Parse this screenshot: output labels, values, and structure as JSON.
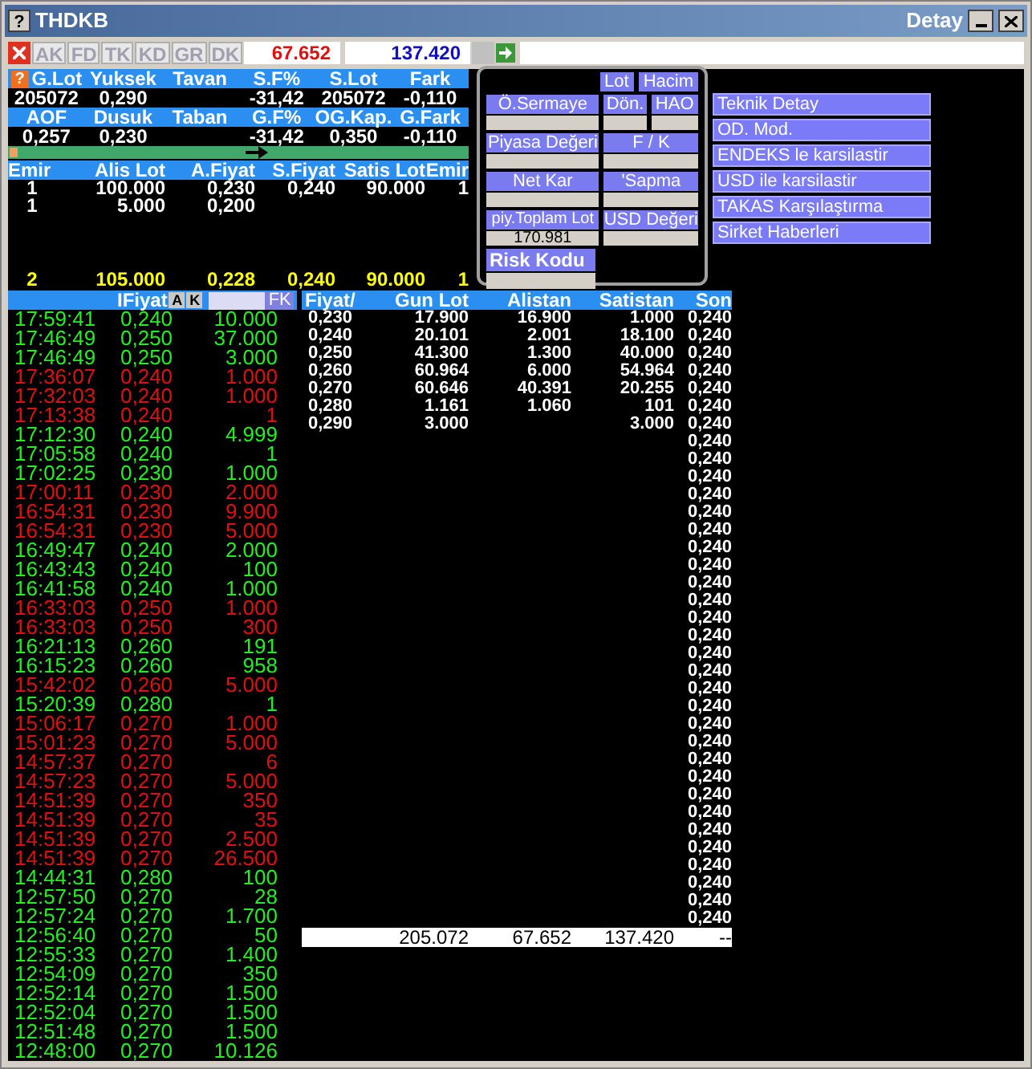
{
  "window": {
    "icon_glyph": "?",
    "title": "THDKB",
    "right_title": "Detay"
  },
  "toolbar": {
    "tabs": [
      "AK",
      "FD",
      "TK",
      "KD",
      "GR",
      "DK"
    ],
    "buy_total": "67.652",
    "sell_total": "137.420"
  },
  "stats": {
    "help_glyph": "?",
    "rows": [
      [
        {
          "header": "G.Lot",
          "value": "205072"
        },
        {
          "header": "Yuksek",
          "value": "0,290"
        },
        {
          "header": "Tavan"
        },
        {
          "header": "S.F%",
          "value": "-31,42"
        },
        {
          "header": "S.Lot",
          "value": "205072"
        },
        {
          "header": "Fark",
          "value": "-0,110"
        }
      ],
      [
        {
          "header": "AOF",
          "value": "0,257"
        },
        {
          "header": "Dusuk",
          "value": "0,230"
        },
        {
          "header": "Taban"
        },
        {
          "header": "G.F%",
          "value": "-31,42"
        },
        {
          "header": "OG.Kap.",
          "value": "0,350"
        },
        {
          "header": "G.Fark",
          "value": "-0,110"
        }
      ]
    ]
  },
  "order_book": {
    "columns": [
      "Emir",
      "Alis Lot",
      "A.Fiyat",
      "S.Fiyat",
      "Satis Lot",
      "Emir"
    ],
    "rows": [
      [
        "1",
        "100.000",
        "0,230",
        "0,240",
        "90.000",
        "1"
      ],
      [
        "1",
        "5.000",
        "0,200",
        null,
        null,
        null
      ]
    ],
    "totals": [
      "2",
      "105.000",
      "0,228",
      "0,240",
      "90.000",
      "1"
    ]
  },
  "info_panel": {
    "toggles": [
      {
        "label": "Lot",
        "selected": false
      },
      {
        "label": "Hacim",
        "selected": false
      }
    ],
    "fields": [
      {
        "label": "Ö.Sermaye"
      },
      {
        "label": "Dön."
      },
      {
        "label": "HAO"
      },
      {
        "label": "Piyasa Değeri"
      },
      {
        "label": "F / K"
      },
      {
        "label": "Net Kar"
      },
      {
        "label": "'Sapma"
      },
      {
        "label": "piy.Toplam Lot",
        "value": "170.981"
      },
      {
        "label": "USD Değeri"
      }
    ],
    "risk_label": "Risk Kodu"
  },
  "menu": [
    "Teknik Detay",
    "OD. Mod.",
    "ENDEKS le karsilastir",
    "USD ile karsilastir",
    "TAKAS Karşılaştırma",
    "Sirket Haberleri"
  ],
  "trades": {
    "header": "IFiyat",
    "buttons": [
      "A",
      "K"
    ],
    "fk": "FK",
    "rows": [
      {
        "time": "17:59:41",
        "price": "0,240",
        "lot": "10.000",
        "color": "#22ee22"
      },
      {
        "time": "17:46:49",
        "price": "0,250",
        "lot": "37.000",
        "color": "#22ee22"
      },
      {
        "time": "17:46:49",
        "price": "0,250",
        "lot": "3.000",
        "color": "#22ee22"
      },
      {
        "time": "17:36:07",
        "price": "0,240",
        "lot": "1.000",
        "color": "#e01010"
      },
      {
        "time": "17:32:03",
        "price": "0,240",
        "lot": "1.000",
        "color": "#e01010"
      },
      {
        "time": "17:13:38",
        "price": "0,240",
        "lot": "1",
        "color": "#e01010"
      },
      {
        "time": "17:12:30",
        "price": "0,240",
        "lot": "4.999",
        "color": "#22ee22"
      },
      {
        "time": "17:05:58",
        "price": "0,240",
        "lot": "1",
        "color": "#22ee22"
      },
      {
        "time": "17:02:25",
        "price": "0,230",
        "lot": "1.000",
        "color": "#22ee22"
      },
      {
        "time": "17:00:11",
        "price": "0,230",
        "lot": "2.000",
        "color": "#e01010"
      },
      {
        "time": "16:54:31",
        "price": "0,230",
        "lot": "9.900",
        "color": "#e01010"
      },
      {
        "time": "16:54:31",
        "price": "0,230",
        "lot": "5.000",
        "color": "#e01010"
      },
      {
        "time": "16:49:47",
        "price": "0,240",
        "lot": "2.000",
        "color": "#22ee22"
      },
      {
        "time": "16:43:43",
        "price": "0,240",
        "lot": "100",
        "color": "#22ee22"
      },
      {
        "time": "16:41:58",
        "price": "0,240",
        "lot": "1.000",
        "color": "#22ee22"
      },
      {
        "time": "16:33:03",
        "price": "0,250",
        "lot": "1.000",
        "color": "#e01010"
      },
      {
        "time": "16:33:03",
        "price": "0,250",
        "lot": "300",
        "color": "#e01010"
      },
      {
        "time": "16:21:13",
        "price": "0,260",
        "lot": "191",
        "color": "#22ee22"
      },
      {
        "time": "16:15:23",
        "price": "0,260",
        "lot": "958",
        "color": "#22ee22"
      },
      {
        "time": "15:42:02",
        "price": "0,260",
        "lot": "5.000",
        "color": "#e01010"
      },
      {
        "time": "15:20:39",
        "price": "0,280",
        "lot": "1",
        "color": "#22ee22"
      },
      {
        "time": "15:06:17",
        "price": "0,270",
        "lot": "1.000",
        "color": "#e01010"
      },
      {
        "time": "15:01:23",
        "price": "0,270",
        "lot": "5.000",
        "color": "#e01010"
      },
      {
        "time": "14:57:37",
        "price": "0,270",
        "lot": "6",
        "color": "#e01010"
      },
      {
        "time": "14:57:23",
        "price": "0,270",
        "lot": "5.000",
        "color": "#e01010"
      },
      {
        "time": "14:51:39",
        "price": "0,270",
        "lot": "350",
        "color": "#e01010"
      },
      {
        "time": "14:51:39",
        "price": "0,270",
        "lot": "35",
        "color": "#e01010"
      },
      {
        "time": "14:51:39",
        "price": "0,270",
        "lot": "2.500",
        "color": "#e01010"
      },
      {
        "time": "14:51:39",
        "price": "0,270",
        "lot": "26.500",
        "color": "#e01010"
      },
      {
        "time": "14:44:31",
        "price": "0,280",
        "lot": "100",
        "color": "#22ee22"
      },
      {
        "time": "12:57:50",
        "price": "0,270",
        "lot": "28",
        "color": "#22ee22"
      },
      {
        "time": "12:57:24",
        "price": "0,270",
        "lot": "1.700",
        "color": "#22ee22"
      },
      {
        "time": "12:56:40",
        "price": "0,270",
        "lot": "50",
        "color": "#22ee22"
      },
      {
        "time": "12:55:33",
        "price": "0,270",
        "lot": "1.400",
        "color": "#22ee22"
      },
      {
        "time": "12:54:09",
        "price": "0,270",
        "lot": "350",
        "color": "#22ee22"
      },
      {
        "time": "12:52:14",
        "price": "0,270",
        "lot": "1.500",
        "color": "#22ee22"
      },
      {
        "time": "12:52:04",
        "price": "0,270",
        "lot": "1.500",
        "color": "#22ee22"
      },
      {
        "time": "12:51:48",
        "price": "0,270",
        "lot": "1.500",
        "color": "#22ee22"
      },
      {
        "time": "12:48:00",
        "price": "0,270",
        "lot": "10.126",
        "color": "#22ee22"
      }
    ]
  },
  "price_table": {
    "columns": [
      "Fiyat/",
      "Gun Lot",
      "Alistan",
      "Satistan",
      "Son"
    ],
    "rows": [
      [
        "0,230",
        "17.900",
        "16.900",
        "1.000"
      ],
      [
        "0,240",
        "20.101",
        "2.001",
        "18.100"
      ],
      [
        "0,250",
        "41.300",
        "1.300",
        "40.000"
      ],
      [
        "0,260",
        "60.964",
        "6.000",
        "54.964"
      ],
      [
        "0,270",
        "60.646",
        "40.391",
        "20.255"
      ],
      [
        "0,280",
        "1.161",
        "1.060",
        "101"
      ],
      [
        "0,290",
        "3.000",
        null,
        "3.000"
      ]
    ],
    "son": [
      "0,240",
      "0,240",
      "0,240",
      "0,240",
      "0,240",
      "0,240",
      "0,240",
      "0,240",
      "0,240",
      "0,240",
      "0,240",
      "0,240",
      "0,240",
      "0,240",
      "0,240",
      "0,240",
      "0,240",
      "0,240",
      "0,240",
      "0,240",
      "0,240",
      "0,240",
      "0,240",
      "0,240",
      "0,240",
      "0,240",
      "0,240",
      "0,240",
      "0,240",
      "0,240",
      "0,240",
      "0,240",
      "0,240",
      "0,240",
      "0,240"
    ],
    "totals": {
      "gun_lot": "205.072",
      "alistan": "67.652",
      "satistan": "137.420",
      "son": "--"
    }
  }
}
